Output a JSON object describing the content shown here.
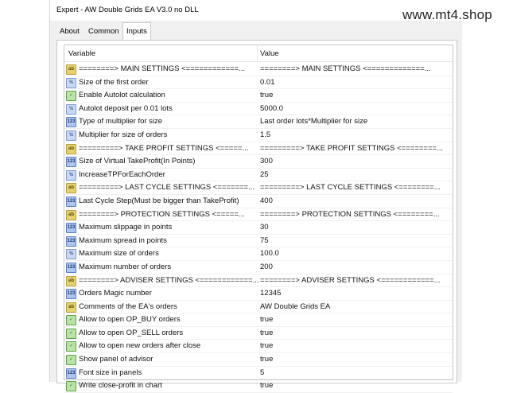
{
  "window": {
    "title": "Expert - AW Double Grids EA V3.0 no DLL",
    "watermark": "www.mt4.shop"
  },
  "tabs": [
    {
      "label": "About"
    },
    {
      "label": "Common"
    },
    {
      "label": "Inputs",
      "active": true
    }
  ],
  "table": {
    "headers": {
      "variable": "Variable",
      "value": "Value"
    },
    "rows": [
      {
        "icon": "string-icon",
        "variable": "========> MAIN SETTINGS  <============...",
        "value": "========> MAIN SETTINGS  <=============..."
      },
      {
        "icon": "double-icon",
        "variable": "Size of the first order",
        "value": "0.01"
      },
      {
        "icon": "bool-icon",
        "variable": "Enable Autolot  calculation",
        "value": "true"
      },
      {
        "icon": "double-icon",
        "variable": "Autolot deposit per 0.01 lots",
        "value": "5000.0"
      },
      {
        "icon": "int-icon",
        "variable": "Type of multiplier for size",
        "value": "Last order lots*Multiplier for size"
      },
      {
        "icon": "double-icon",
        "variable": "Multiplier for size of orders",
        "value": "1.5"
      },
      {
        "icon": "string-icon",
        "variable": "=========> TAKE PROFIT SETTINGS  <=====...",
        "value": "=========> TAKE PROFIT SETTINGS  <========..."
      },
      {
        "icon": "int-icon",
        "variable": "Size of Virtual TakeProfit(In Points)",
        "value": "300"
      },
      {
        "icon": "double-icon",
        "variable": "IncreaseTPForEachOrder",
        "value": "25"
      },
      {
        "icon": "string-icon",
        "variable": "=========> LAST CYCLE SETTINGS  <=======...",
        "value": "=========> LAST CYCLE SETTINGS  <========..."
      },
      {
        "icon": "int-icon",
        "variable": "Last Cycle Step(Must be bigger than TakeProfit)",
        "value": "400"
      },
      {
        "icon": "string-icon",
        "variable": "========> PROTECTION SETTINGS  <=====...",
        "value": "========> PROTECTION SETTINGS  <========..."
      },
      {
        "icon": "int-icon",
        "variable": "Maximum slippage in points",
        "value": "30"
      },
      {
        "icon": "int-icon",
        "variable": "Maximum spread in points",
        "value": "75"
      },
      {
        "icon": "double-icon",
        "variable": "Maximum size of orders",
        "value": "100.0"
      },
      {
        "icon": "int-icon",
        "variable": "Maximum number of orders",
        "value": "200"
      },
      {
        "icon": "string-icon",
        "variable": "========> ADVISER SETTINGS  <============...",
        "value": "========> ADVISER SETTINGS  <============..."
      },
      {
        "icon": "int-icon",
        "variable": "Orders Magic number",
        "value": "12345"
      },
      {
        "icon": "string-icon",
        "variable": "Comments of the EA's orders",
        "value": "AW Double Grids EA"
      },
      {
        "icon": "bool-icon",
        "variable": "Allow to open OP_BUY orders",
        "value": "true"
      },
      {
        "icon": "bool-icon",
        "variable": "Allow to open OP_SELL orders",
        "value": "true"
      },
      {
        "icon": "bool-icon",
        "variable": "Allow to open new orders after close",
        "value": "true"
      },
      {
        "icon": "bool-icon",
        "variable": "Show panel of advisor",
        "value": "true"
      },
      {
        "icon": "int-icon",
        "variable": "Font size in panels",
        "value": "5"
      },
      {
        "icon": "bool-icon",
        "variable": "Write close-profit in chart",
        "value": "true"
      }
    ]
  },
  "icon_glyphs": {
    "string-icon": "ab",
    "double-icon": "½",
    "int-icon": "123",
    "bool-icon": "✓"
  }
}
